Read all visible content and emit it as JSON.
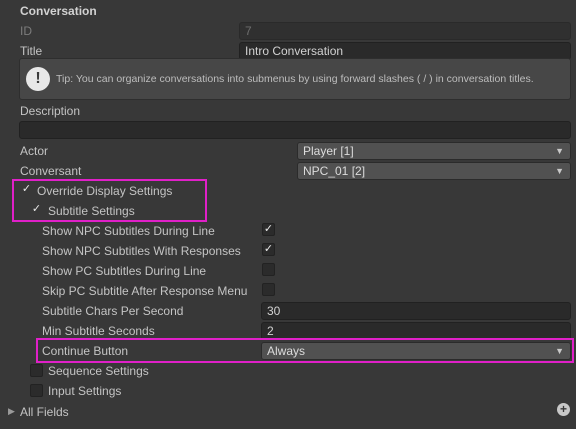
{
  "section": {
    "title": "Conversation"
  },
  "id_field": {
    "label": "ID",
    "value": "7"
  },
  "title_field": {
    "label": "Title",
    "value": "Intro Conversation"
  },
  "tip": {
    "icon": "exclamation-icon",
    "text": "Tip: You can organize conversations into submenus by using forward slashes ( / ) in conversation titles."
  },
  "description": {
    "label": "Description",
    "value": ""
  },
  "actor": {
    "label": "Actor",
    "value": "Player [1]"
  },
  "conversant": {
    "label": "Conversant",
    "value": "NPC_01 [2]"
  },
  "override_display": {
    "label": "Override Display Settings",
    "checked": true
  },
  "subtitle_settings": {
    "label": "Subtitle Settings",
    "expanded": true,
    "rows": [
      {
        "label": "Show NPC Subtitles During Line",
        "checked": true
      },
      {
        "label": "Show NPC Subtitles With Responses",
        "checked": true
      },
      {
        "label": "Show PC Subtitles During Line",
        "checked": false
      },
      {
        "label": "Skip PC Subtitle After Response Menu",
        "checked": false
      }
    ],
    "chars_per_second": {
      "label": "Subtitle Chars Per Second",
      "value": "30"
    },
    "min_seconds": {
      "label": "Min Subtitle Seconds",
      "value": "2"
    },
    "continue_button": {
      "label": "Continue Button",
      "value": "Always"
    }
  },
  "sequence_settings": {
    "label": "Sequence Settings",
    "checked": false
  },
  "input_settings": {
    "label": "Input Settings",
    "checked": false
  },
  "all_fields": {
    "label": "All Fields"
  },
  "colors": {
    "highlight": "#e020c8",
    "background": "#383838"
  }
}
